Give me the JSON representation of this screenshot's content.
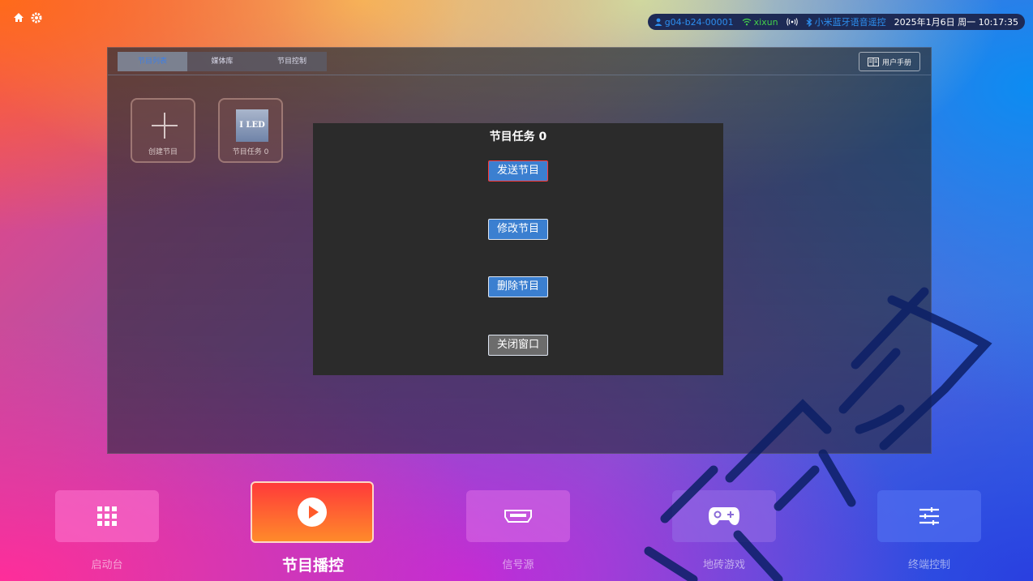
{
  "status": {
    "account": "g04-b24-00001",
    "wifi": "xixun",
    "bluetooth": "小米蓝牙语音遥控",
    "datetime": "2025年1月6日 周一 10:17:35"
  },
  "panel": {
    "tabs": [
      {
        "label": "节目列表",
        "active": true
      },
      {
        "label": "媒体库",
        "active": false
      },
      {
        "label": "节目控制",
        "active": false
      }
    ],
    "manual_label": "用户手册",
    "tiles": [
      {
        "label": "创建节目",
        "icon": "plus-icon"
      },
      {
        "label": "节目任务 0",
        "thumb_text": "I LED"
      }
    ]
  },
  "modal": {
    "title": "节目任务 0",
    "buttons": [
      {
        "label": "发送节目",
        "focused": true
      },
      {
        "label": "修改节目",
        "focused": false
      },
      {
        "label": "删除节目",
        "focused": false
      },
      {
        "label": "关闭窗口",
        "focused": false
      }
    ]
  },
  "dock": [
    {
      "label": "启动台",
      "icon": "grid-icon",
      "active": false
    },
    {
      "label": "节目播控",
      "icon": "play-icon",
      "active": true
    },
    {
      "label": "信号源",
      "icon": "hdmi-icon",
      "active": false
    },
    {
      "label": "地砖游戏",
      "icon": "gamepad-icon",
      "active": false
    },
    {
      "label": "终端控制",
      "icon": "sliders-icon",
      "active": false
    }
  ],
  "colors": {
    "accent": "#3b7fd0",
    "active_tab_text": "#3d7fe6",
    "focus_border": "#ff3a3a",
    "status_pill": "#1d2a55"
  }
}
